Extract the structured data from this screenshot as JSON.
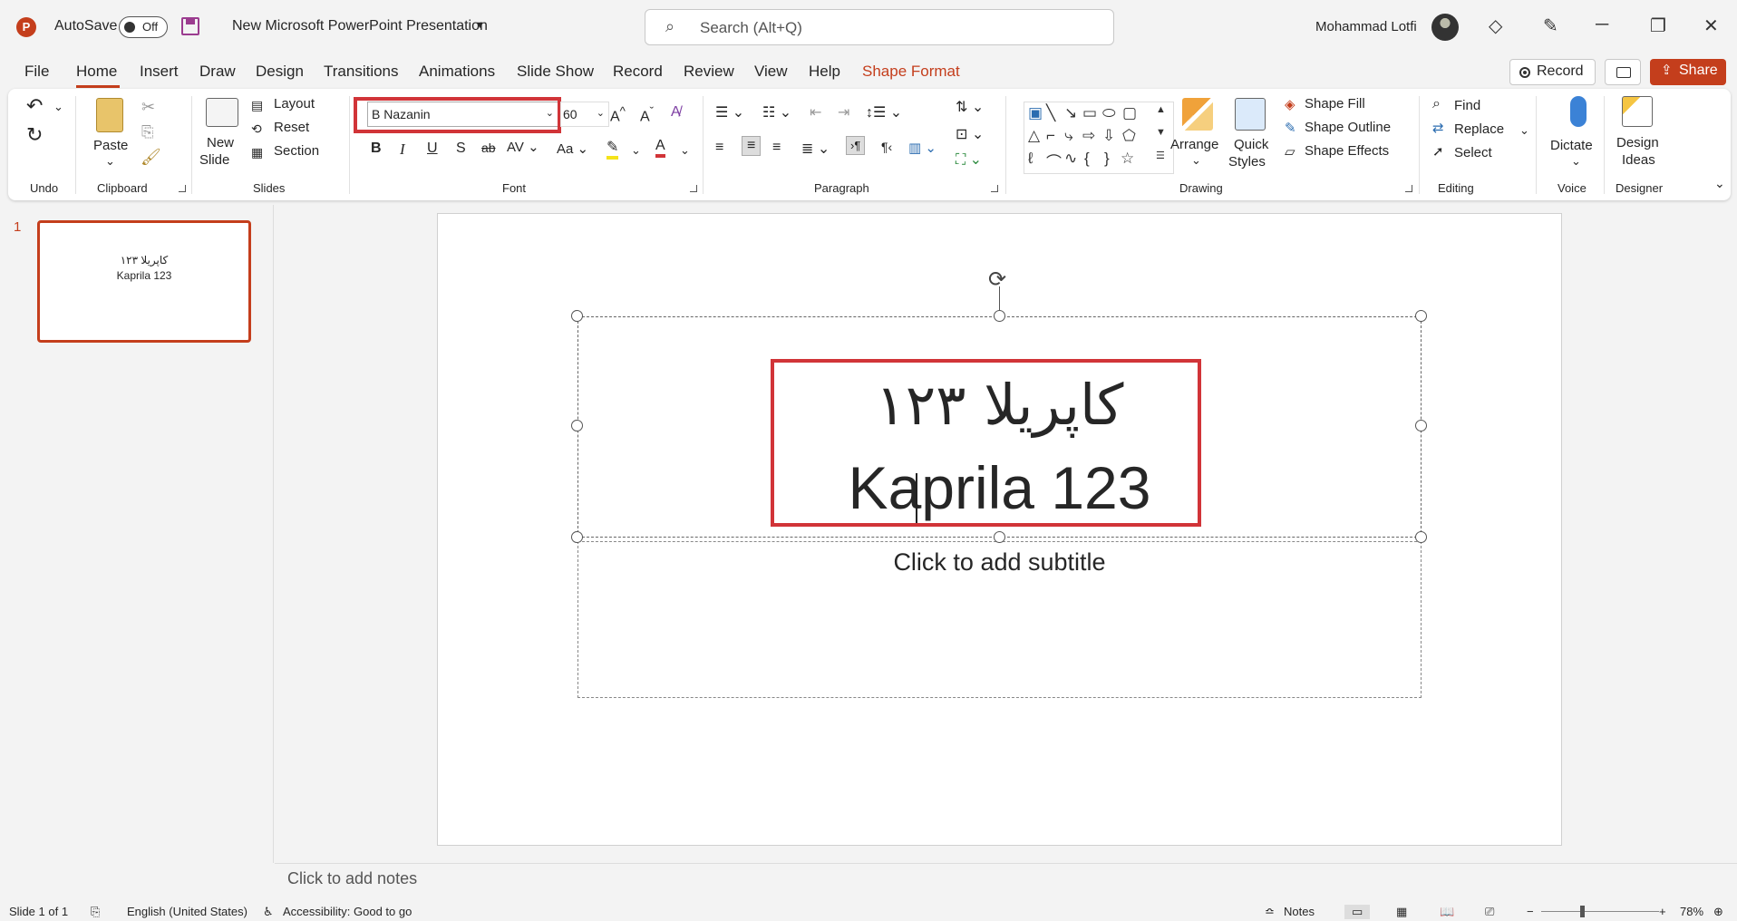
{
  "app": {
    "autosave_label": "AutoSave",
    "autosave_state": "Off",
    "doc_title": "New Microsoft PowerPoint Presentation",
    "search_placeholder": "Search (Alt+Q)",
    "user_name": "Mohammad Lotfi"
  },
  "tabs": [
    "File",
    "Home",
    "Insert",
    "Draw",
    "Design",
    "Transitions",
    "Animations",
    "Slide Show",
    "Record",
    "Review",
    "View",
    "Help",
    "Shape Format"
  ],
  "header_buttons": {
    "record": "Record",
    "share": "Share"
  },
  "ribbon": {
    "groups": {
      "undo": "Undo",
      "clipboard": "Clipboard",
      "slides": "Slides",
      "font": "Font",
      "paragraph": "Paragraph",
      "drawing": "Drawing",
      "editing": "Editing",
      "voice": "Voice",
      "designer": "Designer"
    },
    "paste": "Paste",
    "new_slide": [
      "New",
      "Slide"
    ],
    "layout": "Layout",
    "reset": "Reset",
    "section": "Section",
    "font_name": "B Nazanin",
    "font_size": "60",
    "arrange": "Arrange",
    "quick_styles": [
      "Quick",
      "Styles"
    ],
    "shape_fill": "Shape Fill",
    "shape_outline": "Shape Outline",
    "shape_effects": "Shape Effects",
    "find": "Find",
    "replace": "Replace",
    "select": "Select",
    "dictate": "Dictate",
    "design_ideas": [
      "Design",
      "Ideas"
    ]
  },
  "thumbnail": {
    "number": "1",
    "line1": "کاپریلا ۱۲۳",
    "line2": "Kaprila 123"
  },
  "slide": {
    "title_line1": "کاپریلا ۱۲۳",
    "title_line2": "Kaprila 123",
    "subtitle_placeholder": "Click to add subtitle"
  },
  "notes_placeholder": "Click to add notes",
  "status": {
    "slide_info": "Slide 1 of 1",
    "language": "English (United States)",
    "accessibility": "Accessibility: Good to go",
    "notes": "Notes",
    "zoom": "78%"
  },
  "colors": {
    "accent": "#c43e1c",
    "highlight": "#d13438"
  }
}
